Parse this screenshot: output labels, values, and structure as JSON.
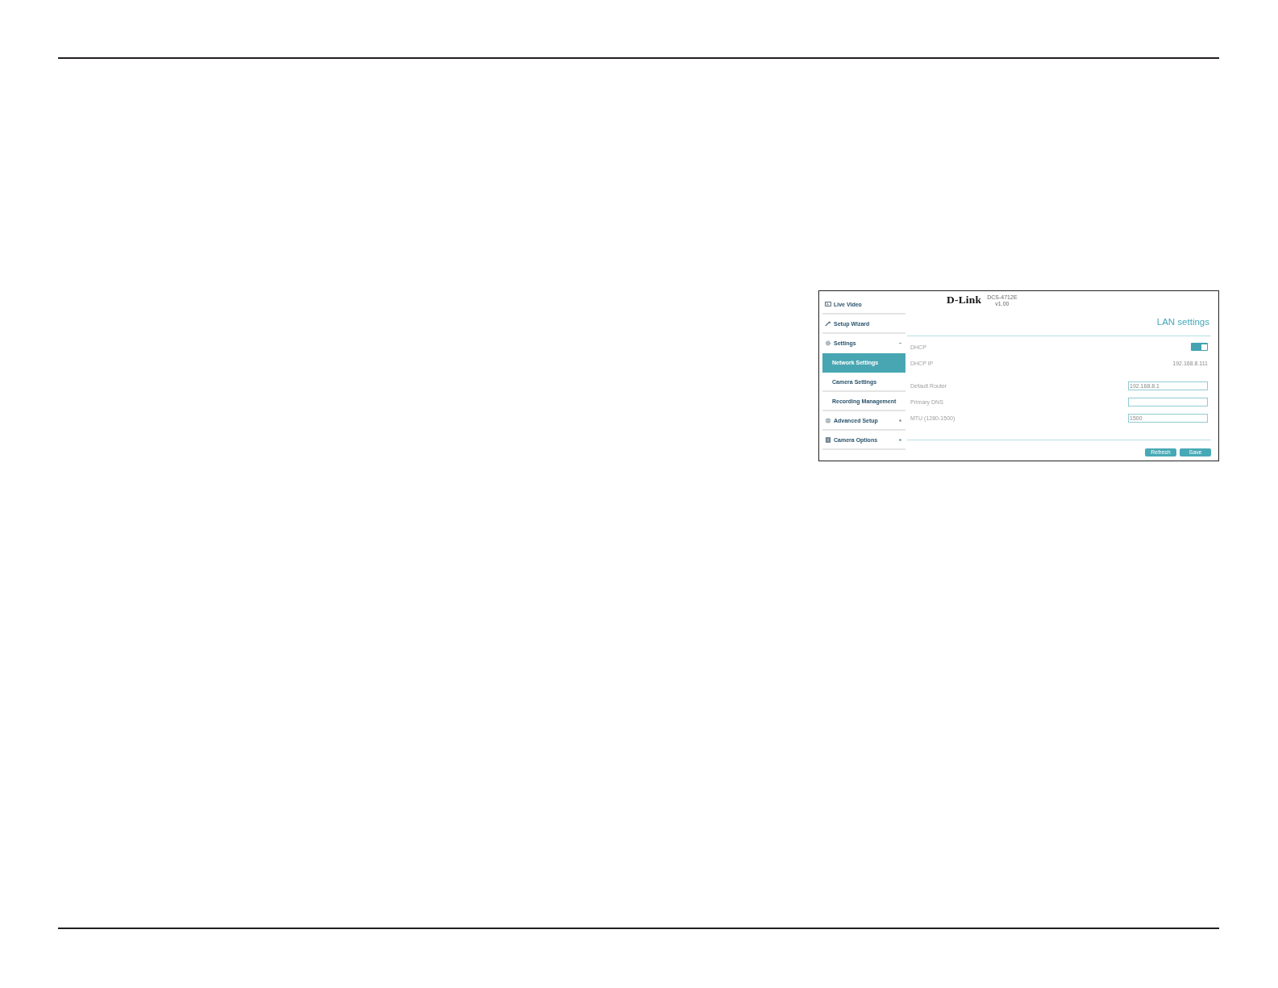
{
  "header": {
    "logo": "D-Link",
    "model": "DCS-4712E",
    "version": "v1.00"
  },
  "sidebar": {
    "items": [
      {
        "kind": "link",
        "label": "Live Video",
        "selected": false
      },
      {
        "kind": "link",
        "label": "Setup Wizard",
        "selected": false
      },
      {
        "kind": "group",
        "label": "Settings",
        "selected": false,
        "expanded": true,
        "children": [
          {
            "label": "Network Settings",
            "selected": true
          },
          {
            "label": "Camera Settings",
            "selected": false
          },
          {
            "label": "Recording Management",
            "selected": false
          }
        ]
      },
      {
        "kind": "group",
        "label": "Advanced Setup",
        "selected": false,
        "expanded": false
      },
      {
        "kind": "group",
        "label": "Camera Options",
        "selected": false,
        "expanded": false
      }
    ]
  },
  "panel": {
    "title": "LAN settings",
    "fields": [
      {
        "kind": "toggle",
        "label": "DHCP",
        "on": true
      },
      {
        "kind": "text",
        "label": "DHCP IP",
        "value": "192.168.8.111"
      },
      {
        "kind": "input",
        "label": "Default Router",
        "value": "192.168.8.1"
      },
      {
        "kind": "input",
        "label": "Primary DNS"
      },
      {
        "kind": "input",
        "label": "MTU (1280-1500)",
        "value": "1500"
      }
    ],
    "buttons": [
      "Refresh",
      "Save"
    ]
  }
}
